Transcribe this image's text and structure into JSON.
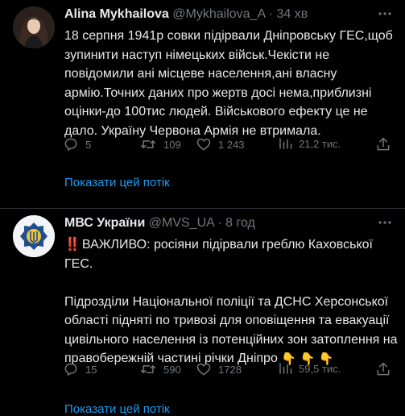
{
  "tweets": [
    {
      "author_name": "Alina Mykhailova",
      "handle": "@Mykhailova_A",
      "separator": "·",
      "time": "34 хв",
      "text": "18 серпня 1941р совки підірвали Дніпровську ГЕС,щоб зупинити наступ німецьких військ.Чекісти не повідомили ані місцеве населення,ані власну армію.Точних даних про жертв досі нема,приблизні оцінки-до 100тис людей. Військового ефекту це не дало. Україну Червона Армія не втримала.",
      "replies": "5",
      "retweets": "109",
      "likes": "1 243",
      "views": "21,2 тис.",
      "show_thread": "Показати цей потік"
    },
    {
      "author_name": "МВС України",
      "handle": "@MVS_UA",
      "separator": "·",
      "time": "8 год",
      "alert_emoji": "‼️",
      "text_line1": "ВАЖЛИВО: росіяни підірвали греблю Каховської ГЕС.",
      "text_para2": "Підрозділи Національної поліції та ДСНС Херсонської області підняті по тривозі для оповіщення та евакуації цивільного населення із потенційних зон затоплення на правобережній частині річки Дніпро",
      "hand_emojis": [
        "👇",
        "👇",
        "👇"
      ],
      "replies": "15",
      "retweets": "590",
      "likes": "1728",
      "views": "59,5 тис.",
      "show_thread": "Показати цей потік"
    }
  ],
  "colors": {
    "background": "#000000",
    "text": "#e7e9ea",
    "muted": "#71767b",
    "link": "#1d9bf0",
    "divider": "#2f3336"
  },
  "icons": [
    "reply-icon",
    "retweet-icon",
    "like-icon",
    "views-icon",
    "share-icon",
    "more-icon"
  ]
}
